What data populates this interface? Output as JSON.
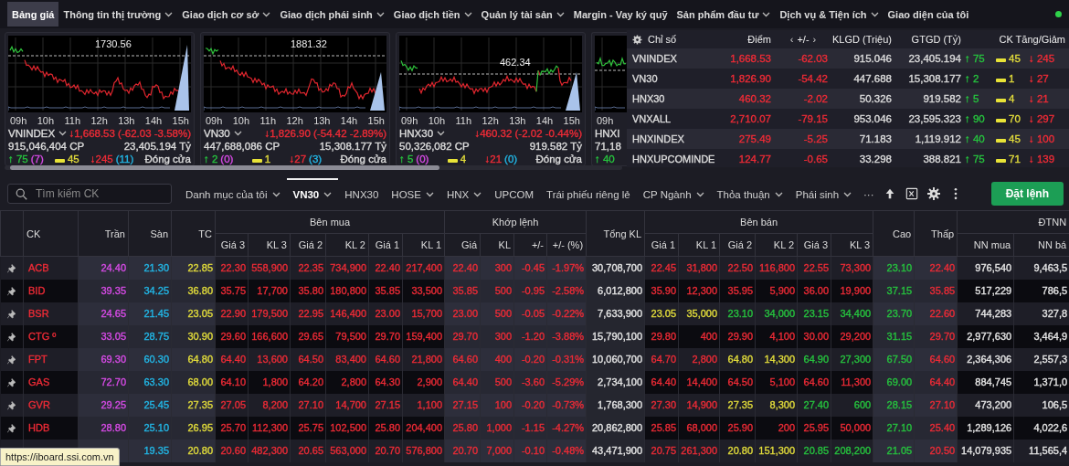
{
  "nav": {
    "items": [
      {
        "label": "Bảng giá",
        "selected": true,
        "has_menu": false
      },
      {
        "label": "Thông tin thị trường",
        "selected": false,
        "has_menu": true
      },
      {
        "label": "Giao dịch cơ sở",
        "selected": false,
        "has_menu": true
      },
      {
        "label": "Giao dịch phái sinh",
        "selected": false,
        "has_menu": true
      },
      {
        "label": "Giao dịch tiền",
        "selected": false,
        "has_menu": true
      },
      {
        "label": "Quản lý tài sản",
        "selected": false,
        "has_menu": true
      },
      {
        "label": "Margin - Vay ký quỹ",
        "selected": false,
        "has_menu": false
      },
      {
        "label": "Sản phẩm đầu tư",
        "selected": false,
        "has_menu": true
      },
      {
        "label": "Dịch vụ & Tiện ích",
        "selected": false,
        "has_menu": true
      },
      {
        "label": "Giao diện của tôi",
        "selected": false,
        "has_menu": false
      }
    ],
    "online": true
  },
  "index_cards": [
    {
      "name": "VNINDEX",
      "reference": "1730.56",
      "hours": [
        "09h",
        "10h",
        "11h",
        "12h",
        "13h",
        "14h",
        "15h"
      ],
      "change": "↓1,668.53 (-62.03 -3.58%)",
      "color": "#ef2b36",
      "volume": "915,046,404 CP",
      "value": "23,405.194 Tỷ",
      "advances": "↑ 75",
      "ceiling": "(7)",
      "unchanged": "45",
      "declines": "↓245",
      "floor": "(11)",
      "session": "Đóng cửa"
    },
    {
      "name": "VN30",
      "reference": "1881.32",
      "hours": [
        "09h",
        "10h",
        "11h",
        "12h",
        "13h",
        "14h",
        "15h"
      ],
      "change": "↓1,826.90 (-54.42 -2.89%)",
      "color": "#ef2b36",
      "volume": "447,688,086 CP",
      "value": "15,308.177 Tỷ",
      "advances": "↑ 2",
      "ceiling": "(0)",
      "unchanged": "1",
      "declines": "↓27",
      "floor": "(3)",
      "session": "Đóng cửa"
    },
    {
      "name": "HNX30",
      "reference": "462.34",
      "hours": [
        "09h",
        "10h",
        "11h",
        "12h",
        "13h",
        "14h",
        "15h"
      ],
      "change": "↓460.32 (-2.02 -0.44%)",
      "color": "#ef2b36",
      "volume": "50,326,082 CP",
      "value": "919.582 Tỷ",
      "advances": "↑ 5",
      "ceiling": "(0)",
      "unchanged": "4",
      "declines": "↓21",
      "floor": "(0)",
      "session": "Đóng cửa"
    },
    {
      "name": "HNXI",
      "hours": [
        "09h"
      ],
      "volume": "71,18",
      "advances": "↑ 40"
    }
  ],
  "index_table": {
    "columns": [
      "Chỉ số",
      "Điểm",
      "+/-",
      "KLGD (Triệu)",
      "GTGD (Tỷ)",
      "CK Tăng/Giảm"
    ],
    "pager": [
      "‹",
      "›"
    ],
    "rows": [
      {
        "name": "VNINDEX",
        "points": "1,668.53",
        "change": "-62.03",
        "color": "#ef2b36",
        "volume": "915.046",
        "value": "23,405.194",
        "advances": "↑ 75",
        "unchanged": "45",
        "declines": "↓ 245"
      },
      {
        "name": "VN30",
        "points": "1,826.90",
        "change": "-54.42",
        "color": "#ef2b36",
        "volume": "447.688",
        "value": "15,308.177",
        "advances": "↑ 2",
        "unchanged": "1",
        "declines": "↓ 27"
      },
      {
        "name": "HNX30",
        "points": "460.32",
        "change": "-2.02",
        "color": "#ef2b36",
        "volume": "50.326",
        "value": "919.582",
        "advances": "↑ 5",
        "unchanged": "4",
        "declines": "↓ 21"
      },
      {
        "name": "VNXALL",
        "points": "2,710.07",
        "change": "-79.15",
        "color": "#ef2b36",
        "volume": "953.046",
        "value": "23,595.323",
        "advances": "↑ 90",
        "unchanged": "70",
        "declines": "↓ 297"
      },
      {
        "name": "HNXINDEX",
        "points": "275.49",
        "change": "-5.25",
        "color": "#ef2b36",
        "volume": "71.183",
        "value": "1,119.912",
        "advances": "↑ 40",
        "unchanged": "45",
        "declines": "↓ 100"
      },
      {
        "name": "HNXUPCOMINDE",
        "points": "124.77",
        "change": "-0.65",
        "color": "#ef2b36",
        "volume": "33.298",
        "value": "388.821",
        "advances": "↑ 75",
        "unchanged": "71",
        "declines": "↓ 139"
      }
    ]
  },
  "toolbar": {
    "search": {
      "placeholder": "Tìm kiếm CK"
    },
    "tabs": [
      {
        "label": "Danh mục của tôi",
        "selected": false,
        "has_menu": true
      },
      {
        "label": "VN30",
        "selected": true,
        "has_menu": true
      },
      {
        "label": "HNX30",
        "selected": false,
        "has_menu": false
      },
      {
        "label": "HOSE",
        "selected": false,
        "has_menu": true
      },
      {
        "label": "HNX",
        "selected": false,
        "has_menu": true
      },
      {
        "label": "UPCOM",
        "selected": false,
        "has_menu": false
      },
      {
        "label": "Trái phiếu riêng lẻ",
        "selected": false,
        "has_menu": false
      },
      {
        "label": "CP Ngành",
        "selected": false,
        "has_menu": true
      },
      {
        "label": "Thỏa thuận",
        "selected": false,
        "has_menu": true
      },
      {
        "label": "Phái sinh",
        "selected": false,
        "has_menu": true
      }
    ],
    "more": "···",
    "order_button": "Đặt lệnh"
  },
  "board": {
    "column_groups": [
      "Bên mua",
      "Khớp lệnh",
      "Bên bán",
      "ĐTNN"
    ],
    "columns": [
      "CK",
      "Trần",
      "Sàn",
      "TC",
      "Giá 3",
      "KL 3",
      "Giá 2",
      "KL 2",
      "Giá 1",
      "KL 1",
      "Giá",
      "KL",
      "+/-",
      "+/- (%)",
      "Tổng KL",
      "Giá 1",
      "KL 1",
      "Giá 2",
      "KL 2",
      "Giá 3",
      "KL 3",
      "Cao",
      "Thấp",
      "NN mua",
      "NN bá"
    ],
    "rows": [
      {
        "cells": [
          {
            "text": "ACB",
            "color": "#ef2b36"
          },
          {
            "text": "24.40",
            "color": "#d94be8"
          },
          {
            "text": "21.30",
            "color": "#22b8e8"
          },
          {
            "text": "22.85",
            "color": "#e3dd3b"
          },
          {
            "text": "22.30",
            "color": "#ef2b36"
          },
          {
            "text": "558,900",
            "color": "#ef2b36"
          },
          {
            "text": "22.35",
            "color": "#ef2b36"
          },
          {
            "text": "734,900",
            "color": "#ef2b36"
          },
          {
            "text": "22.40",
            "color": "#ef2b36"
          },
          {
            "text": "217,400",
            "color": "#ef2b36"
          },
          {
            "text": "22.40",
            "color": "#ef2b36"
          },
          {
            "text": "300",
            "color": "#ef2b36"
          },
          {
            "text": "-0.45",
            "color": "#ef2b36"
          },
          {
            "text": "-1.97%",
            "color": "#ef2b36"
          },
          {
            "text": "30,708,700",
            "color": "#e6e6e6"
          },
          {
            "text": "22.45",
            "color": "#ef2b36"
          },
          {
            "text": "31,800",
            "color": "#ef2b36"
          },
          {
            "text": "22.50",
            "color": "#ef2b36"
          },
          {
            "text": "116,800",
            "color": "#ef2b36"
          },
          {
            "text": "22.55",
            "color": "#ef2b36"
          },
          {
            "text": "73,300",
            "color": "#ef2b36"
          },
          {
            "text": "23.10",
            "color": "#26c33e"
          },
          {
            "text": "22.40",
            "color": "#ef2b36"
          },
          {
            "text": "976,540",
            "color": "#e6e6e6"
          },
          {
            "text": "9,463,5",
            "color": "#e6e6e6"
          }
        ]
      },
      {
        "cells": [
          {
            "text": "BID",
            "color": "#ef2b36"
          },
          {
            "text": "39.35",
            "color": "#d94be8"
          },
          {
            "text": "34.25",
            "color": "#22b8e8"
          },
          {
            "text": "36.80",
            "color": "#e3dd3b"
          },
          {
            "text": "35.75",
            "color": "#ef2b36"
          },
          {
            "text": "17,700",
            "color": "#ef2b36"
          },
          {
            "text": "35.80",
            "color": "#ef2b36"
          },
          {
            "text": "180,800",
            "color": "#ef2b36"
          },
          {
            "text": "35.85",
            "color": "#ef2b36"
          },
          {
            "text": "33,500",
            "color": "#ef2b36"
          },
          {
            "text": "35.85",
            "color": "#ef2b36"
          },
          {
            "text": "500",
            "color": "#ef2b36"
          },
          {
            "text": "-0.95",
            "color": "#ef2b36"
          },
          {
            "text": "-2.58%",
            "color": "#ef2b36"
          },
          {
            "text": "6,012,800",
            "color": "#e6e6e6"
          },
          {
            "text": "35.90",
            "color": "#ef2b36"
          },
          {
            "text": "12,300",
            "color": "#ef2b36"
          },
          {
            "text": "35.95",
            "color": "#ef2b36"
          },
          {
            "text": "5,900",
            "color": "#ef2b36"
          },
          {
            "text": "36.00",
            "color": "#ef2b36"
          },
          {
            "text": "19,900",
            "color": "#ef2b36"
          },
          {
            "text": "37.15",
            "color": "#26c33e"
          },
          {
            "text": "35.85",
            "color": "#ef2b36"
          },
          {
            "text": "517,229",
            "color": "#e6e6e6"
          },
          {
            "text": "786,5",
            "color": "#e6e6e6"
          }
        ]
      },
      {
        "cells": [
          {
            "text": "BSR",
            "color": "#ef2b36"
          },
          {
            "text": "24.65",
            "color": "#d94be8"
          },
          {
            "text": "21.45",
            "color": "#22b8e8"
          },
          {
            "text": "23.05",
            "color": "#e3dd3b"
          },
          {
            "text": "22.90",
            "color": "#ef2b36"
          },
          {
            "text": "179,500",
            "color": "#ef2b36"
          },
          {
            "text": "22.95",
            "color": "#ef2b36"
          },
          {
            "text": "146,400",
            "color": "#ef2b36"
          },
          {
            "text": "23.00",
            "color": "#ef2b36"
          },
          {
            "text": "15,700",
            "color": "#ef2b36"
          },
          {
            "text": "23.00",
            "color": "#ef2b36"
          },
          {
            "text": "500",
            "color": "#ef2b36"
          },
          {
            "text": "-0.05",
            "color": "#ef2b36"
          },
          {
            "text": "-0.22%",
            "color": "#ef2b36"
          },
          {
            "text": "7,633,900",
            "color": "#e6e6e6"
          },
          {
            "text": "23.05",
            "color": "#e3dd3b"
          },
          {
            "text": "35,000",
            "color": "#e3dd3b"
          },
          {
            "text": "23.10",
            "color": "#26c33e"
          },
          {
            "text": "34,000",
            "color": "#26c33e"
          },
          {
            "text": "23.15",
            "color": "#26c33e"
          },
          {
            "text": "34,400",
            "color": "#26c33e"
          },
          {
            "text": "23.70",
            "color": "#26c33e"
          },
          {
            "text": "22.60",
            "color": "#ef2b36"
          },
          {
            "text": "744,283",
            "color": "#e6e6e6"
          },
          {
            "text": "327,8",
            "color": "#e6e6e6"
          }
        ]
      },
      {
        "cells": [
          {
            "text": "CTG º",
            "color": "#ef2b36"
          },
          {
            "text": "33.05",
            "color": "#d94be8"
          },
          {
            "text": "28.75",
            "color": "#22b8e8"
          },
          {
            "text": "30.90",
            "color": "#e3dd3b"
          },
          {
            "text": "29.60",
            "color": "#ef2b36"
          },
          {
            "text": "166,600",
            "color": "#ef2b36"
          },
          {
            "text": "29.65",
            "color": "#ef2b36"
          },
          {
            "text": "79,500",
            "color": "#ef2b36"
          },
          {
            "text": "29.70",
            "color": "#ef2b36"
          },
          {
            "text": "159,400",
            "color": "#ef2b36"
          },
          {
            "text": "29.70",
            "color": "#ef2b36"
          },
          {
            "text": "300",
            "color": "#ef2b36"
          },
          {
            "text": "-1.20",
            "color": "#ef2b36"
          },
          {
            "text": "-3.88%",
            "color": "#ef2b36"
          },
          {
            "text": "15,790,100",
            "color": "#e6e6e6"
          },
          {
            "text": "29.80",
            "color": "#ef2b36"
          },
          {
            "text": "400",
            "color": "#ef2b36"
          },
          {
            "text": "29.90",
            "color": "#ef2b36"
          },
          {
            "text": "4,100",
            "color": "#ef2b36"
          },
          {
            "text": "30.00",
            "color": "#ef2b36"
          },
          {
            "text": "29,200",
            "color": "#ef2b36"
          },
          {
            "text": "31.15",
            "color": "#26c33e"
          },
          {
            "text": "29.70",
            "color": "#ef2b36"
          },
          {
            "text": "2,977,630",
            "color": "#e6e6e6"
          },
          {
            "text": "3,464,9",
            "color": "#e6e6e6"
          }
        ]
      },
      {
        "cells": [
          {
            "text": "FPT",
            "color": "#ef2b36"
          },
          {
            "text": "69.30",
            "color": "#d94be8"
          },
          {
            "text": "60.30",
            "color": "#22b8e8"
          },
          {
            "text": "64.80",
            "color": "#e3dd3b"
          },
          {
            "text": "64.40",
            "color": "#ef2b36"
          },
          {
            "text": "13,600",
            "color": "#ef2b36"
          },
          {
            "text": "64.50",
            "color": "#ef2b36"
          },
          {
            "text": "83,400",
            "color": "#ef2b36"
          },
          {
            "text": "64.60",
            "color": "#ef2b36"
          },
          {
            "text": "21,800",
            "color": "#ef2b36"
          },
          {
            "text": "64.60",
            "color": "#ef2b36"
          },
          {
            "text": "400",
            "color": "#ef2b36"
          },
          {
            "text": "-0.20",
            "color": "#ef2b36"
          },
          {
            "text": "-0.31%",
            "color": "#ef2b36"
          },
          {
            "text": "10,060,700",
            "color": "#e6e6e6"
          },
          {
            "text": "64.70",
            "color": "#ef2b36"
          },
          {
            "text": "2,800",
            "color": "#ef2b36"
          },
          {
            "text": "64.80",
            "color": "#e3dd3b"
          },
          {
            "text": "14,300",
            "color": "#e3dd3b"
          },
          {
            "text": "64.90",
            "color": "#26c33e"
          },
          {
            "text": "27,300",
            "color": "#26c33e"
          },
          {
            "text": "67.50",
            "color": "#26c33e"
          },
          {
            "text": "64.60",
            "color": "#ef2b36"
          },
          {
            "text": "2,364,306",
            "color": "#e6e6e6"
          },
          {
            "text": "2,557,3",
            "color": "#e6e6e6"
          }
        ]
      },
      {
        "cells": [
          {
            "text": "GAS",
            "color": "#ef2b36"
          },
          {
            "text": "72.70",
            "color": "#d94be8"
          },
          {
            "text": "63.30",
            "color": "#22b8e8"
          },
          {
            "text": "68.00",
            "color": "#e3dd3b"
          },
          {
            "text": "64.10",
            "color": "#ef2b36"
          },
          {
            "text": "1,800",
            "color": "#ef2b36"
          },
          {
            "text": "64.20",
            "color": "#ef2b36"
          },
          {
            "text": "2,800",
            "color": "#ef2b36"
          },
          {
            "text": "64.30",
            "color": "#ef2b36"
          },
          {
            "text": "2,900",
            "color": "#ef2b36"
          },
          {
            "text": "64.40",
            "color": "#ef2b36"
          },
          {
            "text": "500",
            "color": "#ef2b36"
          },
          {
            "text": "-3.60",
            "color": "#ef2b36"
          },
          {
            "text": "-5.29%",
            "color": "#ef2b36"
          },
          {
            "text": "2,734,100",
            "color": "#e6e6e6"
          },
          {
            "text": "64.40",
            "color": "#ef2b36"
          },
          {
            "text": "14,400",
            "color": "#ef2b36"
          },
          {
            "text": "64.50",
            "color": "#ef2b36"
          },
          {
            "text": "5,100",
            "color": "#ef2b36"
          },
          {
            "text": "64.60",
            "color": "#ef2b36"
          },
          {
            "text": "11,300",
            "color": "#ef2b36"
          },
          {
            "text": "69.00",
            "color": "#26c33e"
          },
          {
            "text": "64.40",
            "color": "#ef2b36"
          },
          {
            "text": "884,745",
            "color": "#e6e6e6"
          },
          {
            "text": "1,371,0",
            "color": "#e6e6e6"
          }
        ]
      },
      {
        "cells": [
          {
            "text": "GVR",
            "color": "#ef2b36"
          },
          {
            "text": "29.25",
            "color": "#d94be8"
          },
          {
            "text": "25.45",
            "color": "#22b8e8"
          },
          {
            "text": "27.35",
            "color": "#e3dd3b"
          },
          {
            "text": "27.05",
            "color": "#ef2b36"
          },
          {
            "text": "8,200",
            "color": "#ef2b36"
          },
          {
            "text": "27.10",
            "color": "#ef2b36"
          },
          {
            "text": "14,700",
            "color": "#ef2b36"
          },
          {
            "text": "27.15",
            "color": "#ef2b36"
          },
          {
            "text": "1,100",
            "color": "#ef2b36"
          },
          {
            "text": "27.15",
            "color": "#ef2b36"
          },
          {
            "text": "100",
            "color": "#ef2b36"
          },
          {
            "text": "-0.20",
            "color": "#ef2b36"
          },
          {
            "text": "-0.73%",
            "color": "#ef2b36"
          },
          {
            "text": "1,768,300",
            "color": "#e6e6e6"
          },
          {
            "text": "27.30",
            "color": "#ef2b36"
          },
          {
            "text": "14,900",
            "color": "#ef2b36"
          },
          {
            "text": "27.35",
            "color": "#e3dd3b"
          },
          {
            "text": "8,300",
            "color": "#e3dd3b"
          },
          {
            "text": "27.40",
            "color": "#26c33e"
          },
          {
            "text": "600",
            "color": "#26c33e"
          },
          {
            "text": "28.15",
            "color": "#26c33e"
          },
          {
            "text": "27.10",
            "color": "#ef2b36"
          },
          {
            "text": "473,200",
            "color": "#e6e6e6"
          },
          {
            "text": "106,5",
            "color": "#e6e6e6"
          }
        ]
      },
      {
        "cells": [
          {
            "text": "HDB",
            "color": "#ef2b36"
          },
          {
            "text": "28.80",
            "color": "#d94be8"
          },
          {
            "text": "25.10",
            "color": "#22b8e8"
          },
          {
            "text": "26.95",
            "color": "#e3dd3b"
          },
          {
            "text": "25.70",
            "color": "#ef2b36"
          },
          {
            "text": "112,300",
            "color": "#ef2b36"
          },
          {
            "text": "25.75",
            "color": "#ef2b36"
          },
          {
            "text": "102,500",
            "color": "#ef2b36"
          },
          {
            "text": "25.80",
            "color": "#ef2b36"
          },
          {
            "text": "204,400",
            "color": "#ef2b36"
          },
          {
            "text": "25.80",
            "color": "#ef2b36"
          },
          {
            "text": "1,000",
            "color": "#ef2b36"
          },
          {
            "text": "-1.15",
            "color": "#ef2b36"
          },
          {
            "text": "-4.27%",
            "color": "#ef2b36"
          },
          {
            "text": "20,862,800",
            "color": "#e6e6e6"
          },
          {
            "text": "25.85",
            "color": "#ef2b36"
          },
          {
            "text": "68,000",
            "color": "#ef2b36"
          },
          {
            "text": "25.90",
            "color": "#ef2b36"
          },
          {
            "text": "200",
            "color": "#ef2b36"
          },
          {
            "text": "25.95",
            "color": "#ef2b36"
          },
          {
            "text": "50,000",
            "color": "#ef2b36"
          },
          {
            "text": "27.10",
            "color": "#26c33e"
          },
          {
            "text": "25.40",
            "color": "#ef2b36"
          },
          {
            "text": "1,289,126",
            "color": "#e6e6e6"
          },
          {
            "text": "4,022,6",
            "color": "#e6e6e6"
          }
        ]
      },
      {
        "cells": [
          "",
          "",
          {
            "text": "19.35",
            "color": "#22b8e8"
          },
          {
            "text": "20.80",
            "color": "#e3dd3b"
          },
          {
            "text": "20.60",
            "color": "#ef2b36"
          },
          {
            "text": "482,300",
            "color": "#ef2b36"
          },
          {
            "text": "20.65",
            "color": "#ef2b36"
          },
          {
            "text": "563,000",
            "color": "#ef2b36"
          },
          {
            "text": "20.70",
            "color": "#ef2b36"
          },
          {
            "text": "576,800",
            "color": "#ef2b36"
          },
          {
            "text": "20.70",
            "color": "#ef2b36"
          },
          {
            "text": "7,000",
            "color": "#ef2b36"
          },
          {
            "text": "-0.10",
            "color": "#ef2b36"
          },
          {
            "text": "-0.48%",
            "color": "#ef2b36"
          },
          {
            "text": "43,471,900",
            "color": "#e6e6e6"
          },
          {
            "text": "20.75",
            "color": "#ef2b36"
          },
          {
            "text": "261,300",
            "color": "#ef2b36"
          },
          {
            "text": "20.80",
            "color": "#e3dd3b"
          },
          {
            "text": "151,300",
            "color": "#e3dd3b"
          },
          {
            "text": "20.85",
            "color": "#26c33e"
          },
          {
            "text": "208,200",
            "color": "#26c33e"
          },
          {
            "text": "21.05",
            "color": "#26c33e"
          },
          {
            "text": "20.50",
            "color": "#ef2b36"
          },
          {
            "text": "14,079,935",
            "color": "#e6e6e6"
          },
          {
            "text": "11,565,4",
            "color": "#e6e6e6"
          }
        ]
      }
    ]
  },
  "status_tooltip": "https://iboard.ssi.com.vn"
}
